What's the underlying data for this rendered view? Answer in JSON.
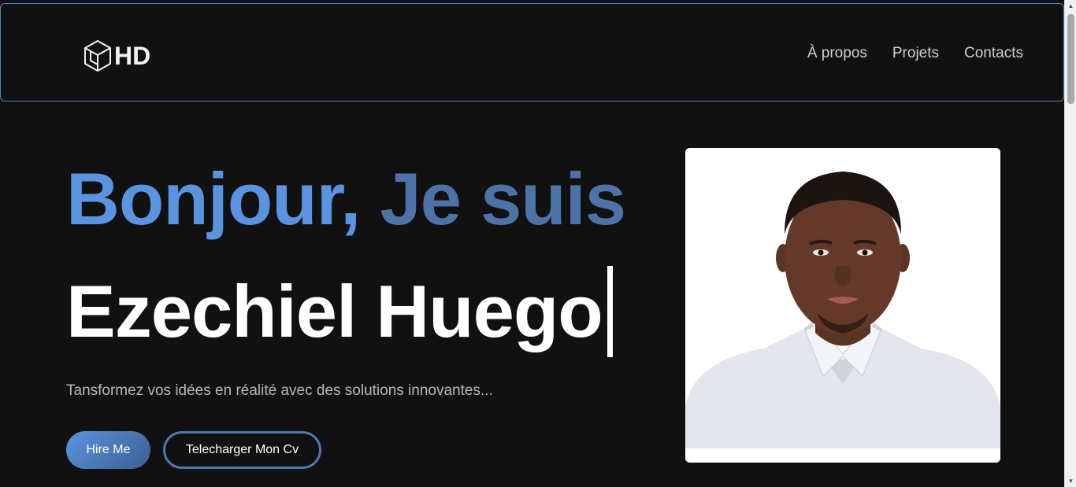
{
  "header": {
    "logo_text": "HD",
    "logo_icon": "cube-icon",
    "nav": [
      {
        "label": "À propos"
      },
      {
        "label": "Projets"
      },
      {
        "label": "Contacts"
      }
    ]
  },
  "hero": {
    "greeting_word1": "Bonjour,",
    "greeting_word2": "Je suis",
    "name": "Ezechiel Huego",
    "tagline": "Tansformez vos idées en réalité avec des solutions innovantes...",
    "hire_button": "Hire Me",
    "cv_button": "Telecharger Mon Cv"
  },
  "colors": {
    "background": "#111112",
    "accent_blue": "#5a94e0",
    "accent_blue_dark": "#4d73a6",
    "header_border": "#4f83c8"
  }
}
